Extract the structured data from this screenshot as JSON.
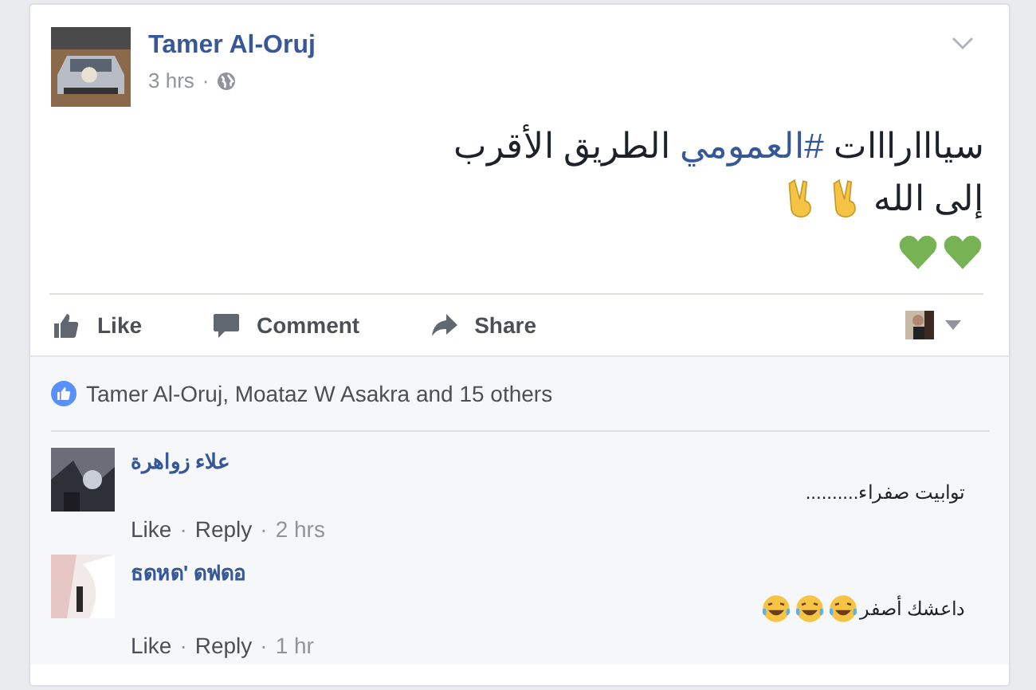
{
  "post": {
    "author": "Tamer Al-Oruj",
    "time": "3 hrs",
    "separator": "·",
    "lines": [
      {
        "kind": "hashtag",
        "before": "سيااارااات ",
        "hashtag": "#العمومي",
        "after": " الطريق الأقرب"
      },
      {
        "kind": "text",
        "text": "إلى الله",
        "emoji": [
          {
            "kind": "victory"
          },
          {
            "kind": "victory"
          }
        ]
      },
      {
        "kind": "emoji",
        "emoji": [
          {
            "kind": "heart"
          },
          {
            "kind": "heart"
          }
        ]
      }
    ],
    "like_button": {
      "kind": "like",
      "label": "Like"
    },
    "comment_button": {
      "kind": "comment",
      "label": "Comment"
    },
    "share_button": {
      "kind": "share",
      "label": "Share"
    },
    "likes": "Tamer Al-Oruj, Moataz W Asakra and 15 others"
  },
  "comments": [
    {
      "author": "علاء زواهرة",
      "text": "توابيت صفراء..........",
      "like_link": "Like",
      "reply_link": "Reply",
      "time": "2 hrs",
      "separator": "·"
    },
    {
      "author": "ธดหด' ดฟดอ",
      "text": "داعشك أصفر",
      "emoji": [
        {
          "kind": "laugh"
        },
        {
          "kind": "laugh"
        },
        {
          "kind": "laugh"
        }
      ],
      "like_link": "Like",
      "reply_link": "Reply",
      "time": "1 hr",
      "separator": "·"
    }
  ]
}
